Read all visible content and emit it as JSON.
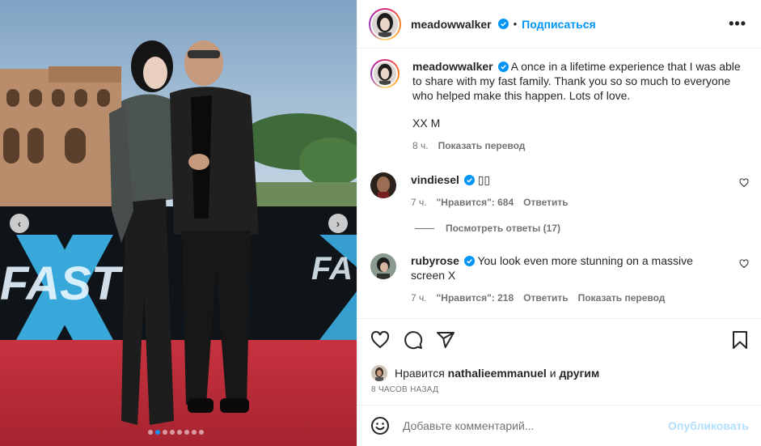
{
  "post": {
    "author": "meadowwalker",
    "follow_label": "Подписаться",
    "bullet": "•",
    "more_icon": "more-dots-icon",
    "carousel": {
      "total": 8,
      "active": 2
    }
  },
  "caption": {
    "author": "meadowwalker",
    "text": "A once in a lifetime experience that I was able to share with my fast family. Thank you so so much to everyone who helped make this happen. Lots of love.",
    "signoff": "XX M",
    "time": "8 ч.",
    "translate": "Показать перевод"
  },
  "comments": [
    {
      "author": "vindiesel",
      "text": "▯▯",
      "time": "7 ч.",
      "likes": "\"Нравится\": 684",
      "reply": "Ответить"
    },
    {
      "author": "rubyrose",
      "text": "You look even more stunning on a massive screen X",
      "time": "7 ч.",
      "likes": "\"Нравится\": 218",
      "reply": "Ответить",
      "translate": "Показать перевод"
    }
  ],
  "view_replies": "Посмотреть ответы (17)",
  "likes_line": {
    "prefix": "Нравится",
    "user": "nathalieemmanuel",
    "connector": "и",
    "suffix": "другим"
  },
  "timestamp": "8 ЧАСОВ НАЗАД",
  "add_comment": {
    "placeholder": "Добавьте комментарий...",
    "post_label": "Опубликовать"
  },
  "colors": {
    "accent": "#0095f6",
    "verified": "#0095f6",
    "post_disabled": "#b2dffc"
  }
}
